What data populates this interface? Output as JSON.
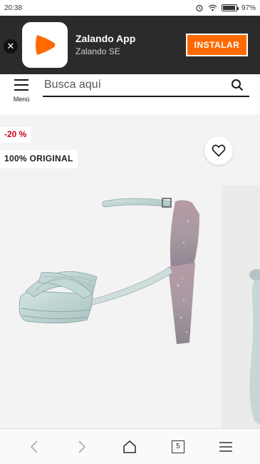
{
  "status_bar": {
    "time": "20:38",
    "battery": "97%",
    "battery_level": 0.97
  },
  "app_banner": {
    "app_name": "Zalando App",
    "publisher": "Zalando SE",
    "install_label": "INSTALAR",
    "logo_icon": "zalando-play-logo",
    "brand_color": "#ff6900"
  },
  "header": {
    "menu_label": "Menú",
    "search_placeholder": "Busca aquí"
  },
  "product": {
    "discount": "-20 %",
    "badge": "100% ORIGINAL",
    "discount_color": "#d0021b"
  },
  "browser_nav": {
    "tabs_count": "5",
    "icons": [
      "back-icon",
      "forward-icon",
      "home-icon",
      "tabs-icon",
      "menu-icon"
    ]
  }
}
